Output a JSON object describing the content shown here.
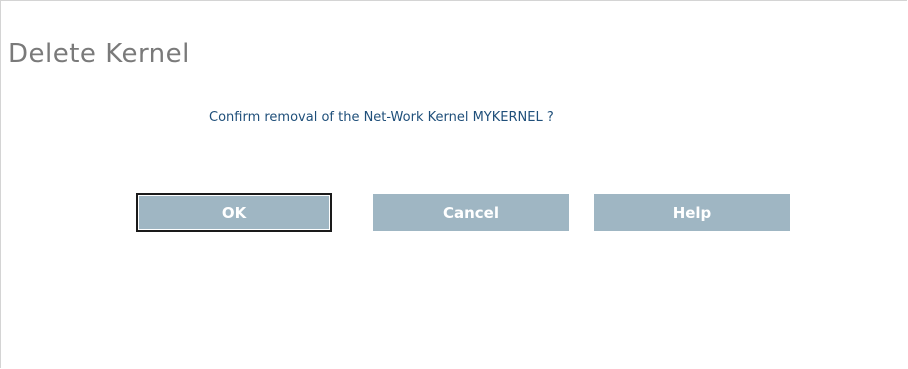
{
  "dialog": {
    "title": "Delete Kernel",
    "message": "Confirm removal of the Net-Work Kernel MYKERNEL ?",
    "buttons": {
      "ok": "OK",
      "cancel": "Cancel",
      "help": "Help"
    }
  },
  "colors": {
    "title": "#7a7a7a",
    "message": "#1f4f7a",
    "button_bg": "#9fb6c3",
    "button_text": "#ffffff"
  }
}
